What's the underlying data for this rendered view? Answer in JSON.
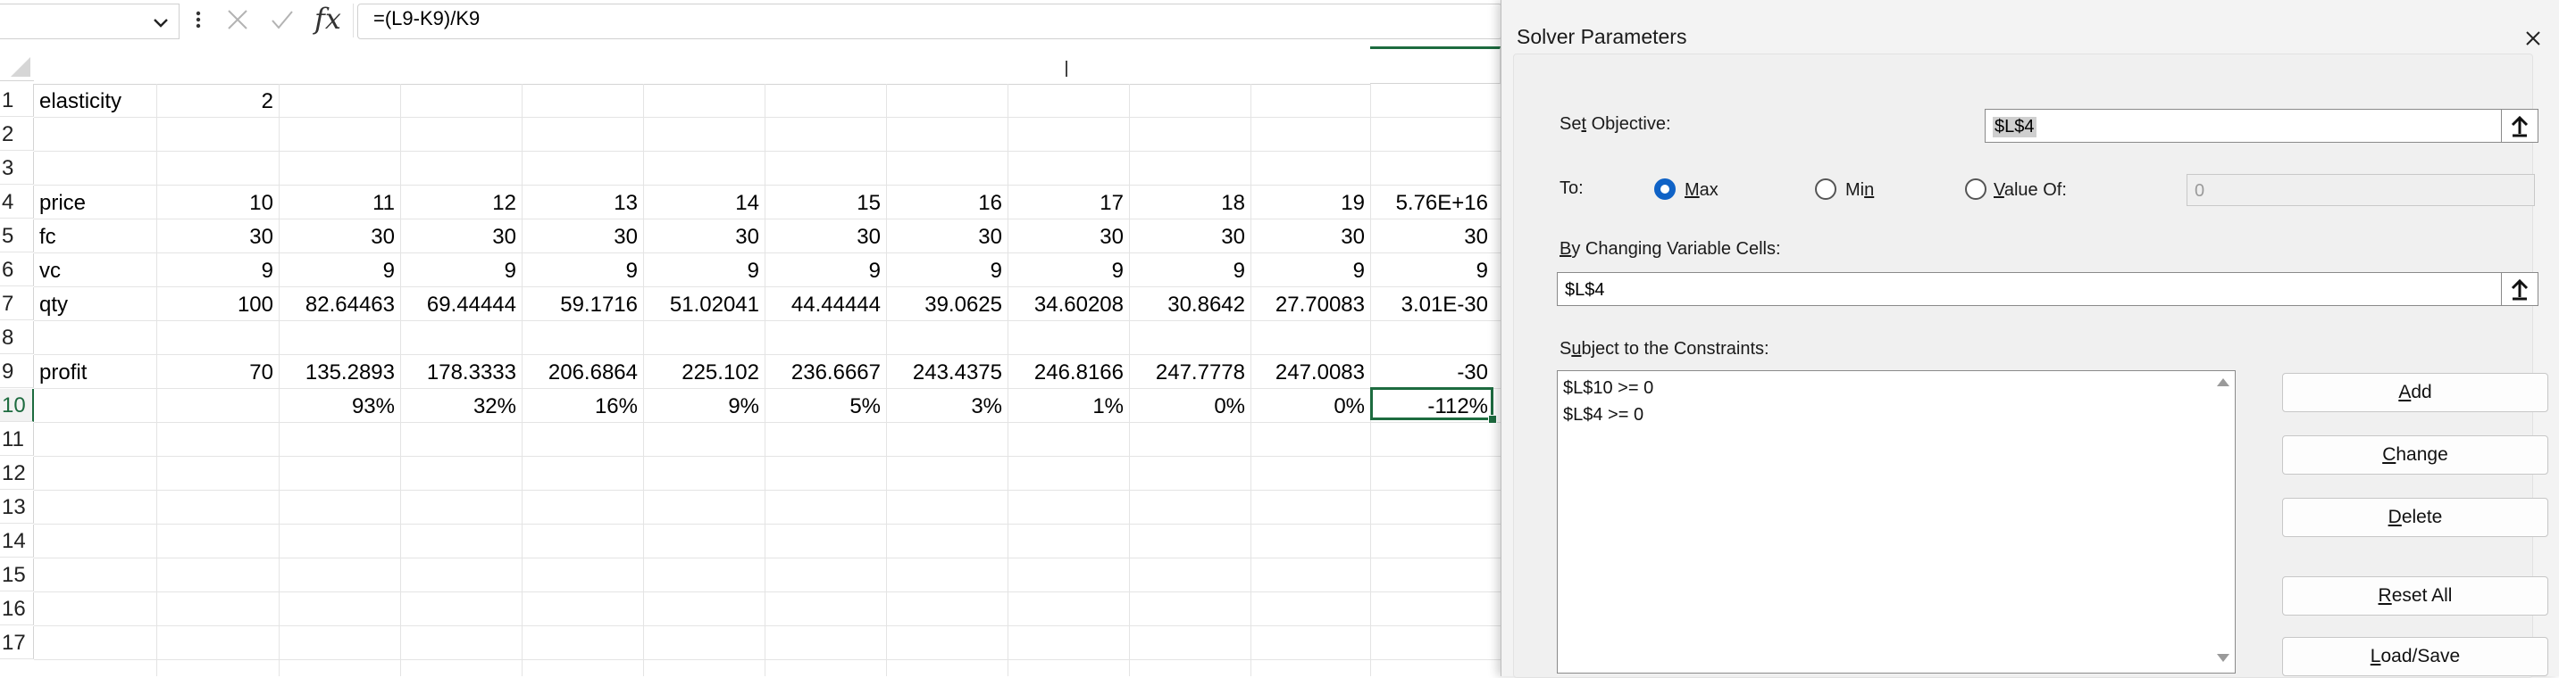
{
  "formula_bar": {
    "name_box_value": "",
    "formula": "=(L9-K9)/K9",
    "fx_label": "fx"
  },
  "sheet": {
    "row_numbers": [
      "1",
      "2",
      "3",
      "4",
      "5",
      "6",
      "7",
      "8",
      "9",
      "10",
      "11",
      "12",
      "13",
      "14",
      "15",
      "16",
      "17"
    ],
    "active_row": "10",
    "rows": {
      "r1": {
        "A": "elasticity",
        "B": "2"
      },
      "r4": {
        "A": "price",
        "B": "10",
        "C": "11",
        "D": "12",
        "E": "13",
        "F": "14",
        "G": "15",
        "H": "16",
        "I": "17",
        "J": "18",
        "K": "19",
        "L": "5.76E+16"
      },
      "r5": {
        "A": "fc",
        "B": "30",
        "C": "30",
        "D": "30",
        "E": "30",
        "F": "30",
        "G": "30",
        "H": "30",
        "I": "30",
        "J": "30",
        "K": "30",
        "L": "30"
      },
      "r6": {
        "A": "vc",
        "B": "9",
        "C": "9",
        "D": "9",
        "E": "9",
        "F": "9",
        "G": "9",
        "H": "9",
        "I": "9",
        "J": "9",
        "K": "9",
        "L": "9"
      },
      "r7": {
        "A": "qty",
        "B": "100",
        "C": "82.64463",
        "D": "69.44444",
        "E": "59.1716",
        "F": "51.02041",
        "G": "44.44444",
        "H": "39.0625",
        "I": "34.60208",
        "J": "30.8642",
        "K": "27.70083",
        "L": "3.01E-30"
      },
      "r9": {
        "A": "profit",
        "B": "70",
        "C": "135.2893",
        "D": "178.3333",
        "E": "206.6864",
        "F": "225.102",
        "G": "236.6667",
        "H": "243.4375",
        "I": "246.8166",
        "J": "247.7778",
        "K": "247.0083",
        "L": "-30"
      },
      "r10": {
        "C": "93%",
        "D": "32%",
        "E": "16%",
        "F": "9%",
        "G": "5%",
        "H": "3%",
        "I": "1%",
        "J": "0%",
        "K": "0%",
        "L": "-112%"
      }
    }
  },
  "solver": {
    "title": "Solver Parameters",
    "set_objective": {
      "pre": "Se",
      "u": "t",
      "post": " Objective:",
      "value": "$L$4"
    },
    "to": {
      "label": "To:",
      "options": [
        {
          "pre": "",
          "u": "M",
          "post": "ax",
          "selected": true
        },
        {
          "pre": "Mi",
          "u": "n",
          "post": "",
          "selected": false
        },
        {
          "pre": "",
          "u": "V",
          "post": "alue Of:",
          "selected": false
        }
      ],
      "value_of": "0"
    },
    "by_changing": {
      "pre": "",
      "u": "B",
      "post": "y Changing Variable Cells:",
      "value": "$L$4"
    },
    "constraints": {
      "pre": "S",
      "u": "u",
      "post": "bject to the Constraints:",
      "items": [
        "$L$10 >= 0",
        "$L$4 >= 0"
      ]
    },
    "buttons": {
      "add": {
        "pre": "",
        "u": "A",
        "post": "dd"
      },
      "change": {
        "pre": "",
        "u": "C",
        "post": "hange"
      },
      "delete": {
        "pre": "",
        "u": "D",
        "post": "elete"
      },
      "reset": {
        "pre": "",
        "u": "R",
        "post": "eset All"
      },
      "load": {
        "pre": "",
        "u": "L",
        "post": "oad/Save"
      }
    }
  },
  "colors": {
    "excel_green": "#1d6b3f",
    "radio_blue": "#0f62c6"
  }
}
